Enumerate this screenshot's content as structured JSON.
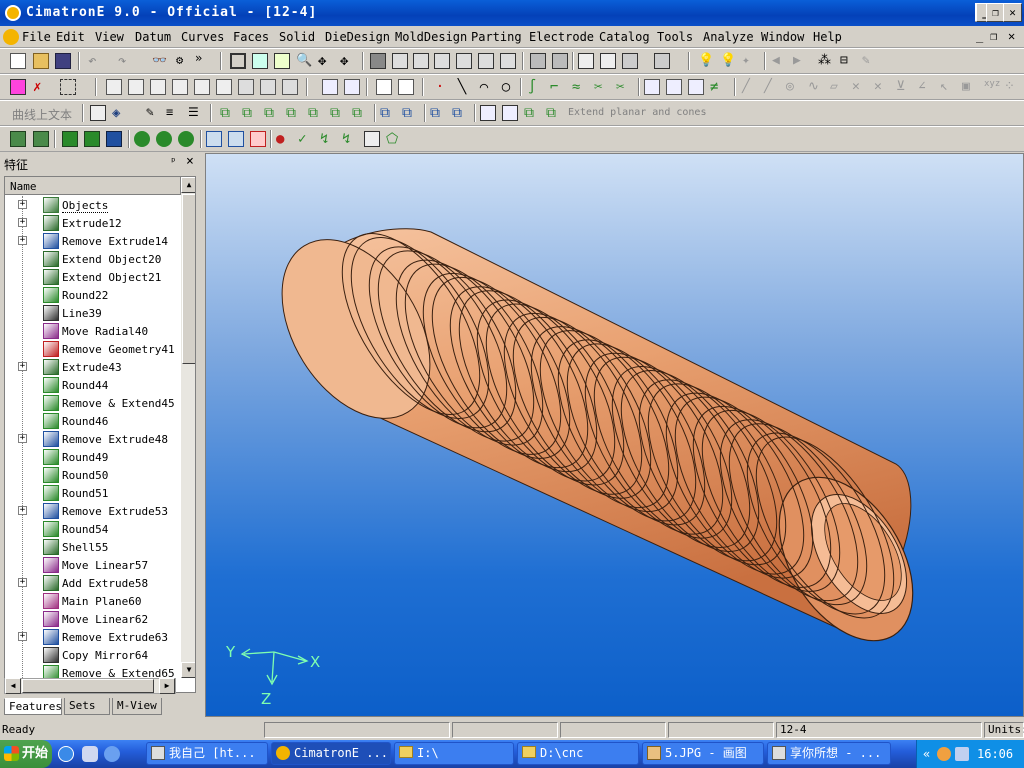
{
  "window": {
    "title": "CimatronE 9.0 - Official - [12-4]",
    "icon": "cimatron-app-icon"
  },
  "menubar": {
    "items": [
      "File",
      "Edit",
      "View",
      "Datum",
      "Curves",
      "Faces",
      "Solid",
      "DieDesign",
      "MoldDesign",
      "Parting",
      "Electrode",
      "Catalog",
      "Tools",
      "Analyze",
      "Window",
      "Help"
    ]
  },
  "toolbar3": {
    "text_button": "曲线上文本",
    "extend_label": "Extend planar and cones"
  },
  "panel": {
    "title": "特征",
    "pin_symbol": "ᵖ",
    "close_symbol": "×",
    "column_header": "Name",
    "tree": [
      {
        "label": "Objects",
        "expand": true,
        "icon": "objects-icon",
        "color": "#3a7a3a"
      },
      {
        "label": "Extrude12",
        "expand": true,
        "icon": "extrude-icon",
        "color": "#2a6a2a"
      },
      {
        "label": "Remove Extrude14",
        "expand": true,
        "icon": "remove-extrude-icon",
        "color": "#2050a0"
      },
      {
        "label": "Extend Object20",
        "expand": false,
        "icon": "extend-object-icon",
        "color": "#2a6a2a"
      },
      {
        "label": "Extend Object21",
        "expand": false,
        "icon": "extend-object-icon",
        "color": "#2a6a2a"
      },
      {
        "label": "Round22",
        "expand": false,
        "icon": "round-icon",
        "color": "#2a8a2a"
      },
      {
        "label": "Line39",
        "expand": false,
        "icon": "line-icon",
        "color": "#303030"
      },
      {
        "label": "Move Radial40",
        "expand": false,
        "icon": "move-radial-icon",
        "color": "#8a2a8a"
      },
      {
        "label": "Remove Geometry41",
        "expand": false,
        "icon": "remove-geometry-icon",
        "color": "#c02020"
      },
      {
        "label": "Extrude43",
        "expand": true,
        "icon": "extrude-icon",
        "color": "#2a6a2a"
      },
      {
        "label": "Round44",
        "expand": false,
        "icon": "round-icon",
        "color": "#2a8a2a"
      },
      {
        "label": "Remove & Extend45",
        "expand": false,
        "icon": "remove-extend-icon",
        "color": "#2a8a2a"
      },
      {
        "label": "Round46",
        "expand": false,
        "icon": "round-icon",
        "color": "#2a8a2a"
      },
      {
        "label": "Remove Extrude48",
        "expand": true,
        "icon": "remove-extrude-icon",
        "color": "#2050a0"
      },
      {
        "label": "Round49",
        "expand": false,
        "icon": "round-icon",
        "color": "#2a8a2a"
      },
      {
        "label": "Round50",
        "expand": false,
        "icon": "round-icon",
        "color": "#2a8a2a"
      },
      {
        "label": "Round51",
        "expand": false,
        "icon": "round-icon",
        "color": "#2a8a2a"
      },
      {
        "label": "Remove Extrude53",
        "expand": true,
        "icon": "remove-extrude-icon",
        "color": "#2050a0"
      },
      {
        "label": "Round54",
        "expand": false,
        "icon": "round-icon",
        "color": "#2a8a2a"
      },
      {
        "label": "Shell55",
        "expand": false,
        "icon": "shell-icon",
        "color": "#2a6a2a"
      },
      {
        "label": "Move Linear57",
        "expand": false,
        "icon": "move-linear-icon",
        "color": "#8a2a8a"
      },
      {
        "label": "Add Extrude58",
        "expand": true,
        "icon": "add-extrude-icon",
        "color": "#2a6a2a"
      },
      {
        "label": "Main Plane60",
        "expand": false,
        "icon": "plane-icon",
        "color": "#a03080"
      },
      {
        "label": "Move Linear62",
        "expand": false,
        "icon": "move-linear-icon",
        "color": "#8a2a8a"
      },
      {
        "label": "Remove Extrude63",
        "expand": true,
        "icon": "remove-extrude-icon",
        "color": "#2050a0"
      },
      {
        "label": "Copy Mirror64",
        "expand": false,
        "icon": "copy-mirror-icon",
        "color": "#303030"
      },
      {
        "label": "Remove & Extend65",
        "expand": false,
        "icon": "remove-extend-icon",
        "color": "#2a8a2a"
      }
    ],
    "tabs": [
      "Features",
      "Sets",
      "M-View"
    ]
  },
  "viewport": {
    "axes": {
      "x": "X",
      "y": "Y",
      "z": "Z"
    },
    "model_color": "#e8a070"
  },
  "status": {
    "ready": "Ready",
    "file": "12-4",
    "units": "Units:"
  },
  "taskbar": {
    "start": "开始",
    "tasks": [
      "我自己 [ht...",
      "CimatronE ...",
      "I:\\",
      "D:\\cnc",
      "5.JPG - 画图",
      "享你所想 - ..."
    ],
    "tray_chevron": "«",
    "clock": "16:06"
  }
}
